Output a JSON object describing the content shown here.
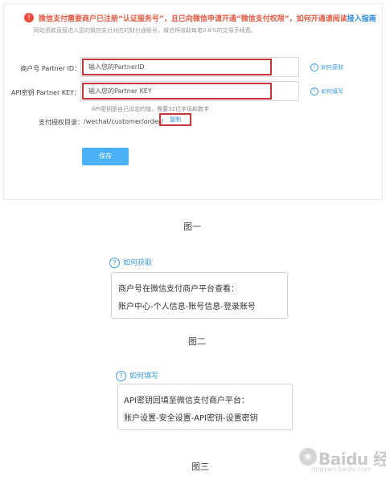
{
  "panel": {
    "notice_text": "微信支付需要商户已注册“认证服务号”，且已向微信申请开通“微信支付权限”，如何开通请阅读",
    "notice_link": "接入指南",
    "subnote": "网站资款直接进入您的微信支付对应的财付通账号，微信将收取每笔0.6%的交易手续费。",
    "partner_id": {
      "label": "商户号 Partner ID：",
      "placeholder": "输入您的PartnerID",
      "help": "如何获取"
    },
    "partner_key": {
      "label": "API密钥 Partner KEY：",
      "placeholder": "输入您的Partner KEY",
      "help": "如何填写"
    },
    "key_hint": "API密钥是自己设定的值，需要32位字母和数字",
    "auth_dir": {
      "label": "支付授权目录：",
      "value": "/wechat/customer/order/",
      "copy_label": "复制"
    },
    "save_label": "保存"
  },
  "captions": {
    "fig1": "图一",
    "fig2": "图二",
    "fig3": "图三"
  },
  "info1": {
    "title": "如何获取",
    "line1": "商户号在微信支付商户平台查看：",
    "line2": "账户中心-个人信息-账号信息-登录账号"
  },
  "info2": {
    "title": "如何填写",
    "line1": "API密钥回填至微信支付商户平台：",
    "line2": "账户设置-安全设置-API密钥-设置密钥"
  },
  "watermark": {
    "brand": "Baidu 经验",
    "sub": "jingyan.baidu.com"
  },
  "colors": {
    "highlight": "#c7343a",
    "link": "#3a9bd8",
    "button": "#49b1f5",
    "warning": "#e25b45"
  }
}
